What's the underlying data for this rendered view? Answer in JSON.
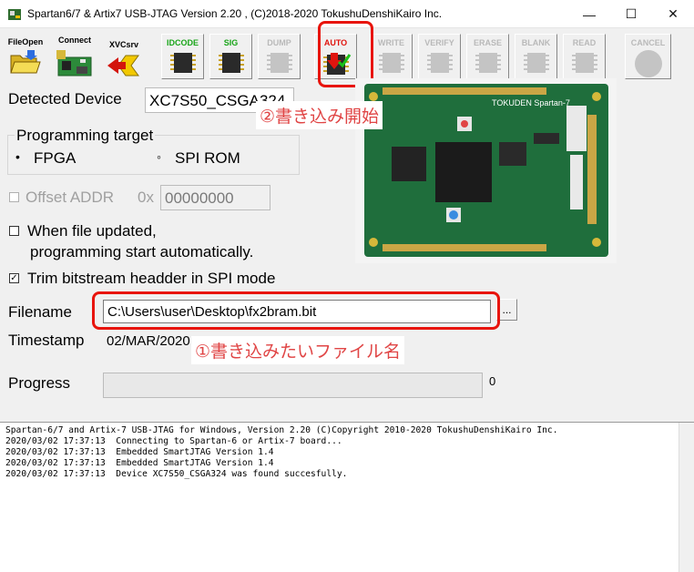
{
  "window": {
    "title": "Spartan6/7 & Artix7  USB-JTAG Version 2.20 , (C)2018-2020 TokushuDenshiKairo Inc.",
    "minimize": "—",
    "maximize": "☐",
    "close": "✕"
  },
  "toolbar": {
    "fileopen": "FileOpen",
    "connect": "Connect",
    "xvcsrv": "XVCsrv",
    "idcode": "IDCODE",
    "sig": "SIG",
    "dump": "DUMP",
    "auto": "AUTO",
    "write": "WRITE",
    "verify": "VERIFY",
    "erase": "ERASE",
    "blank": "BLANK",
    "read": "READ",
    "cancel": "CANCEL"
  },
  "device": {
    "label": "Detected Device",
    "value": "XC7S50_CSGA324"
  },
  "programming": {
    "legend": "Programming target",
    "fpga": "FPGA",
    "spi": "SPI ROM",
    "selected": "FPGA",
    "dot_on": "•",
    "dot_off": "◦"
  },
  "offset": {
    "label": "Offset ADDR",
    "prefix": "0x",
    "value": "00000000"
  },
  "options": {
    "auto_line1": "When file updated,",
    "auto_line2": "programming start automatically.",
    "trim": "Trim bitstream headder in SPI mode",
    "check": "✓"
  },
  "file": {
    "label": "Filename",
    "value": "C:\\Users\\user\\Desktop\\fx2bram.bit",
    "browse": "...",
    "ts_label": "Timestamp",
    "ts_value": "02/MAR/2020 17:37:31"
  },
  "progress": {
    "label": "Progress",
    "value": "0"
  },
  "annotations": {
    "step1": "①書き込みたいファイル名",
    "step2": "②書き込み開始"
  },
  "log": [
    "Spartan-6/7 and Artix-7 USB-JTAG for Windows, Version 2.20 (C)Copyright 2010-2020 TokushuDenshiKairo Inc.",
    "",
    "2020/03/02 17:37:13  Connecting to Spartan-6 or Artix-7 board...",
    "2020/03/02 17:37:13  Embedded SmartJTAG Version 1.4",
    "2020/03/02 17:37:13  Embedded SmartJTAG Version 1.4",
    "2020/03/02 17:37:13  Device XC7S50_CSGA324 was found succesfully."
  ],
  "colors": {
    "accent_red": "#e8140c",
    "green_label": "#19a519"
  }
}
